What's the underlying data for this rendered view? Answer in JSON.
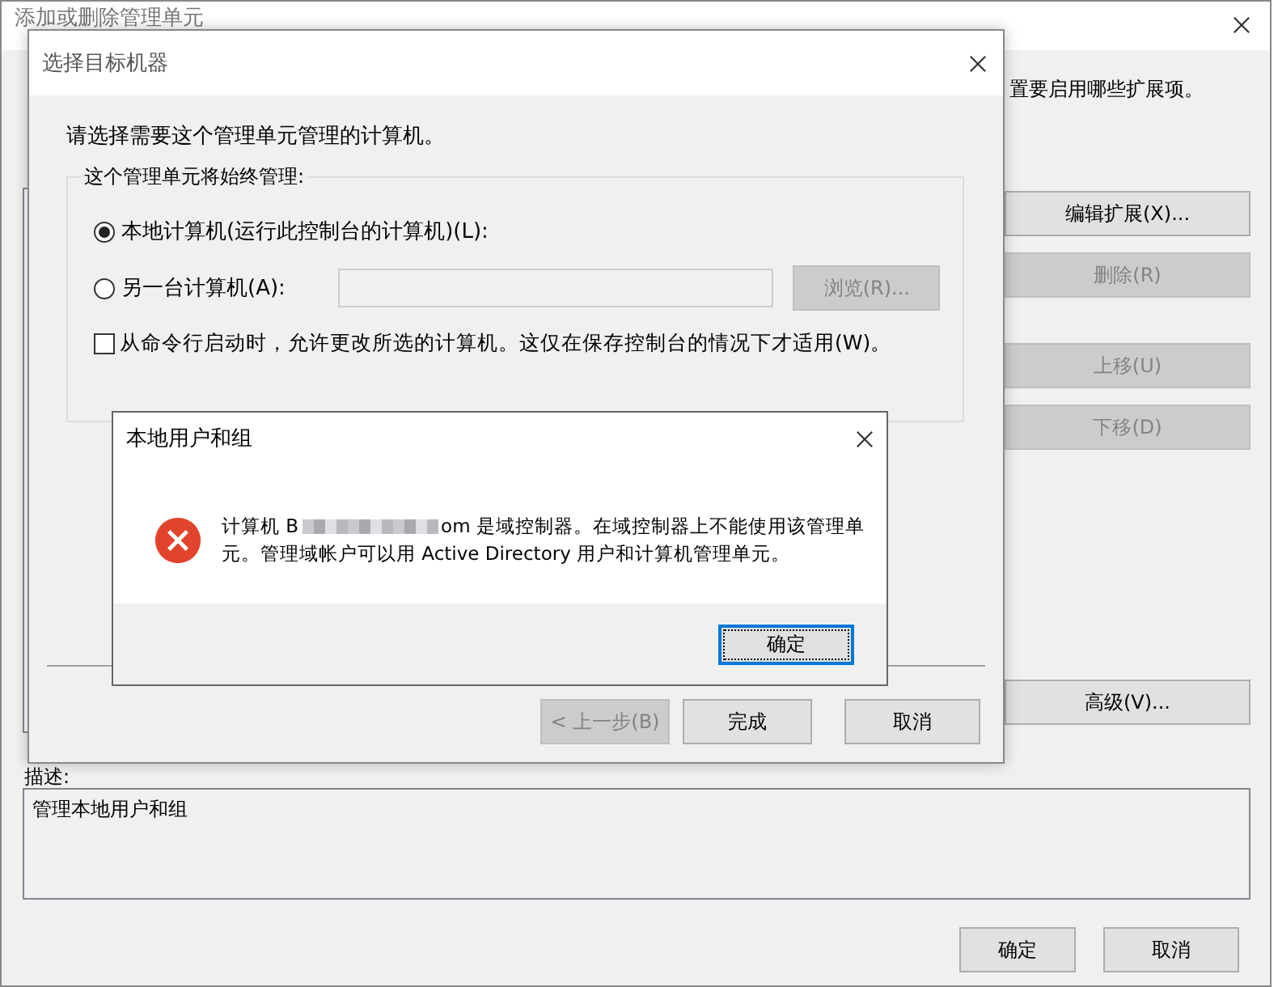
{
  "main_window": {
    "title": "添加或删除管理单元",
    "intro_tail": "置要启用哪些扩展项。",
    "buttons": [
      {
        "label": "编辑扩展(X)...",
        "disabled": false
      },
      {
        "label": "删除(R)",
        "disabled": true
      },
      {
        "label": "上移(U)",
        "disabled": true
      },
      {
        "label": "下移(D)",
        "disabled": true
      },
      {
        "label": "高级(V)...",
        "disabled": false
      }
    ],
    "description_label": "描述:",
    "description": "管理本地用户和组",
    "footer_buttons": [
      "确定",
      "取消"
    ]
  },
  "wizard": {
    "title": "选择目标机器",
    "prompt": "请选择需要这个管理单元管理的计算机。",
    "group_label": "这个管理单元将始终管理:",
    "options": [
      {
        "label": "本地计算机(运行此控制台的计算机)(L):",
        "selected": true
      },
      {
        "label": "另一台计算机(A):",
        "selected": false
      }
    ],
    "browse_button": {
      "label": "浏览(R)...",
      "disabled": true
    },
    "checkbox": {
      "label": "从命令行启动时，允许更改所选的计算机。这仅在保存控制台的情况下才适用(W)。",
      "checked": false
    },
    "buttons": [
      {
        "label": "< 上一步(B)",
        "disabled": true
      },
      {
        "label": "完成",
        "disabled": false
      },
      {
        "label": "取消",
        "disabled": false
      }
    ]
  },
  "error_dialog": {
    "title": "本地用户和组",
    "message_start": "计算机 B",
    "message_end": "om 是域控制器。在域控制器上不能使用该管理单元。管理域帐户可以用 Active Directory 用户和计算机管理单元。",
    "button": "确定"
  }
}
